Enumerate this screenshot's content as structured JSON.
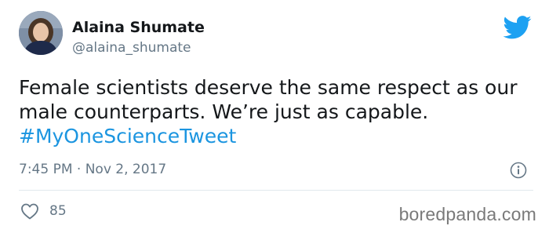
{
  "author": {
    "display_name": "Alaina Shumate",
    "handle": "@alaina_shumate",
    "avatar_icon": "profile-photo"
  },
  "tweet": {
    "line1": "Female scientists deserve the same respect as our",
    "line2": "male counterparts. We’re just as capable.",
    "hashtag": "#MyOneScienceTweet",
    "timestamp": "7:45 PM · Nov 2, 2017",
    "like_count": "85"
  },
  "icons": {
    "brand": "twitter-bird-icon",
    "info": "info-icon",
    "like": "heart-icon"
  },
  "colors": {
    "brand_blue": "#1da1f2",
    "hashtag_blue": "#1b95e0",
    "muted_text": "#657786"
  },
  "watermark": "boredpanda.com"
}
